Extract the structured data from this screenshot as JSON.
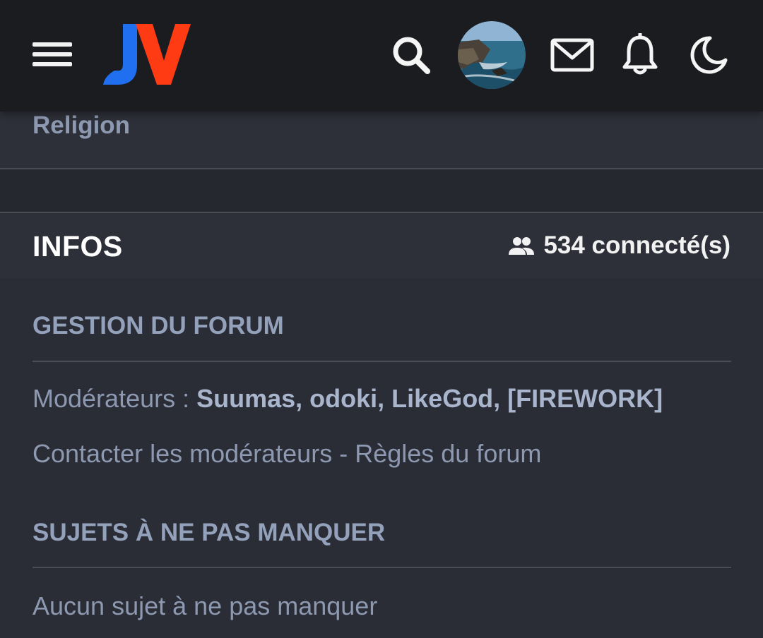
{
  "header": {
    "logo_text": "JV",
    "colors": {
      "background": "#1b1c1f",
      "logo_j": "#1f6ff0",
      "logo_v": "#ff3b14"
    }
  },
  "religion_label": "Religion",
  "infos": {
    "title": "INFOS",
    "connected": "534 connecté(s)"
  },
  "gestion": {
    "title": "GESTION DU FORUM",
    "moderators_label": "Modérateurs : ",
    "moderators": "Suumas, odoki, LikeGod, [FIREWORK]",
    "contact": "Contacter les modérateurs",
    "separator": " - ",
    "rules": "Règles du forum"
  },
  "sujets": {
    "title": "SUJETS À NE PAS MANQUER",
    "empty": "Aucun sujet à ne pas manquer"
  }
}
